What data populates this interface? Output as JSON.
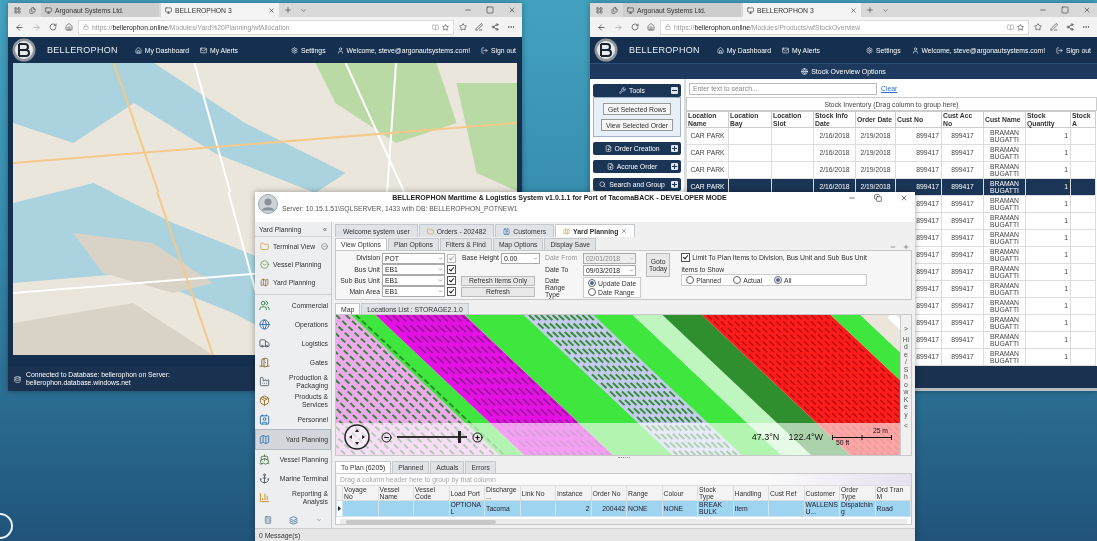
{
  "browser_windows": [
    {
      "kind": "map",
      "tabs": [
        {
          "label": "Argonaut Systems Ltd.",
          "selected": false
        },
        {
          "label": "BELLEROPHON 3",
          "selected": true
        }
      ],
      "url": "https://**bellerophon.online**/Modules/Yard%20Planning/wfAllocation",
      "nav": {
        "brand": "BELLEROPHON",
        "dashboard": "My Dashboard",
        "alerts": "My Alerts",
        "settings": "Settings",
        "welcome": "Welcome, steve@argonautsystems.com!",
        "sign_out": "Sign out"
      },
      "footer": "Connected to Database: bellerophon on Server: bellerophon.database.windows.net"
    },
    {
      "kind": "stock",
      "tabs": [
        {
          "label": "Argonaut Systems Ltd.",
          "selected": false
        },
        {
          "label": "BELLEROPHON 3",
          "selected": true
        }
      ],
      "url": "https://**bellerophon.online**/Modules/Products/wfStockOverview",
      "nav": {
        "brand": "BELLEROPHON",
        "dashboard": "My Dashboard",
        "alerts": "My Alerts",
        "settings": "Settings",
        "welcome": "Welcome, steve@argonautsystems.com!",
        "sign_out": "Sign out"
      },
      "options_bar": "Stock Overview Options",
      "tool_panels": [
        {
          "title": "Tools",
          "expanded": true,
          "buttons": [
            "Get Selected Rows",
            "View Selected Order"
          ]
        },
        {
          "title": "Order Creation",
          "expanded": false
        },
        {
          "title": "Accrue Order",
          "expanded": false
        },
        {
          "title": "Search and Group",
          "expanded": false
        }
      ],
      "search": {
        "placeholder": "Enter text to search...",
        "clear": "Clear"
      },
      "group_hint": "Stock Inventory (Drag column to group here)",
      "table": {
        "columns": [
          "Location Name",
          "Location Bay",
          "Location Slot",
          "Stock Info Date",
          "Order Date",
          "Cust No",
          "Cust Acc No",
          "Cust Name",
          "Stock Quantity",
          "Stock A"
        ],
        "rows": [
          {
            "selected": false,
            "cells": [
              "CAR PARK",
              null,
              null,
              "2/16/2018",
              "2/19/2018",
              "899417",
              "899417",
              "BRAMAN BUGATTI",
              "1"
            ]
          },
          {
            "selected": false,
            "cells": [
              "CAR PARK",
              null,
              null,
              "2/16/2018",
              "2/19/2018",
              "899417",
              "899417",
              "BRAMAN BUGATTI",
              "1"
            ]
          },
          {
            "selected": false,
            "cells": [
              "CAR PARK",
              null,
              null,
              "2/16/2018",
              "2/19/2018",
              "899417",
              "899417",
              "BRAMAN BUGATTI",
              "1"
            ]
          },
          {
            "selected": true,
            "cells": [
              "CAR PARK",
              null,
              null,
              "2/16/2018",
              "2/19/2018",
              "899417",
              "899417",
              "BRAMAN BUGATTI",
              "1"
            ]
          },
          {
            "selected": false,
            "cells": [
              null,
              null,
              null,
              null,
              null,
              "899417",
              "899417",
              "BRAMAN BUGATTI",
              "1"
            ]
          },
          {
            "selected": false,
            "cells": [
              null,
              null,
              null,
              null,
              null,
              "899417",
              "899417",
              "BRAMAN BUGATTI",
              "1"
            ]
          },
          {
            "selected": false,
            "cells": [
              null,
              null,
              null,
              null,
              null,
              "899417",
              "899417",
              "BRAMAN BUGATTI",
              "1"
            ]
          },
          {
            "selected": false,
            "cells": [
              null,
              null,
              null,
              null,
              null,
              "899417",
              "899417",
              "BRAMAN BUGATTI",
              "1"
            ]
          },
          {
            "selected": false,
            "cells": [
              null,
              null,
              null,
              null,
              null,
              "899417",
              "899417",
              "BRAMAN BUGATTI",
              "1"
            ]
          },
          {
            "selected": false,
            "cells": [
              null,
              null,
              null,
              null,
              null,
              "899417",
              "899417",
              "BRAMAN BUGATTI",
              "1"
            ]
          },
          {
            "selected": false,
            "cells": [
              null,
              null,
              null,
              null,
              null,
              "899417",
              "899417",
              "BRAMAN BUGATTI",
              "1"
            ]
          },
          {
            "selected": false,
            "cells": [
              null,
              null,
              null,
              null,
              null,
              "899417",
              "899417",
              "BRAMAN BUGATTI",
              "1"
            ]
          },
          {
            "selected": false,
            "cells": [
              null,
              null,
              null,
              null,
              null,
              "899417",
              "899417",
              "BRAMAN BUGATTI",
              "1"
            ]
          },
          {
            "selected": false,
            "cells": [
              null,
              null,
              null,
              null,
              null,
              "899417",
              "899417",
              "BRAMAN BUGATTI",
              "1"
            ]
          }
        ]
      }
    }
  ],
  "app": {
    "title": "BELLEROPHON Maritime & Logistics System v1.0.1.1 for Port of TacomaBACK - DEVELOPER MODE",
    "server": "Server: 10.15.1.51\\SQLSERVER, 1433 with DB: BELLEROPHON_POTNEW1",
    "sidebar": {
      "title": "Yard Planning",
      "collapse": "«",
      "quick_items": [
        "Terminal View",
        "Vessel Planning",
        "Yard Planning"
      ],
      "modules": [
        {
          "label": "Commercial",
          "selected": false
        },
        {
          "label": "Operations",
          "selected": false
        },
        {
          "label": "Logistics",
          "selected": false
        },
        {
          "label": "Gates",
          "selected": false
        },
        {
          "label": "Production & Packaging",
          "selected": false
        },
        {
          "label": "Products & Services",
          "selected": false
        },
        {
          "label": "Personnel",
          "selected": false
        },
        {
          "label": "Yard Planning",
          "selected": true
        },
        {
          "label": "Vessel Planning",
          "selected": false
        },
        {
          "label": "Marine Terminal",
          "selected": false
        },
        {
          "label": "Reporting & Analysis",
          "selected": false
        }
      ]
    },
    "doc_tabs": [
      {
        "label": "Welcome system user",
        "selected": false
      },
      {
        "label": "Orders - 202482",
        "selected": false
      },
      {
        "label": "Customers",
        "selected": false
      },
      {
        "label": "Yard Planning",
        "selected": true
      }
    ],
    "option_tabs": [
      {
        "label": "View Options",
        "selected": true
      },
      {
        "label": "Plan Options",
        "selected": false
      },
      {
        "label": "Filters & Find",
        "selected": false
      },
      {
        "label": "Map Options",
        "selected": false
      },
      {
        "label": "Display Save",
        "selected": false
      }
    ],
    "form": {
      "combos": [
        {
          "label": "Division",
          "value": "POT",
          "checked": true,
          "disabled": true
        },
        {
          "label": "Bus Unit",
          "value": "EB1",
          "checked": true,
          "disabled": false
        },
        {
          "label": "Sub Bus Unit",
          "value": "EB1",
          "checked": true,
          "disabled": false
        },
        {
          "label": "Main Area",
          "value": "EB1",
          "checked": true,
          "disabled": false
        }
      ],
      "base_height": {
        "label": "Base Height",
        "value": "0.00"
      },
      "buttons": [
        "Refresh Items Only",
        "Refresh"
      ],
      "dates": [
        {
          "label": "Date From",
          "value": "02/01/2018",
          "disabled": true
        },
        {
          "label": "Date To",
          "value": "09/03/2018",
          "disabled": false
        }
      ],
      "date_range_type": {
        "label": "Date Range Type",
        "options": [
          {
            "label": "Update Date",
            "selected": true
          },
          {
            "label": "Date Range",
            "selected": false
          }
        ]
      },
      "goto_today": "Goto Today",
      "limit": {
        "label": "Limit To Plan Items to Division, Bus Unit and Sub Bus Unit",
        "checked": true
      },
      "items_to_show": {
        "label": "Items to Show",
        "options": [
          {
            "label": "Planned",
            "selected": false
          },
          {
            "label": "Actual",
            "selected": false
          },
          {
            "label": "All",
            "selected": true
          }
        ]
      }
    },
    "map_tabs": [
      {
        "label": "Map",
        "selected": true
      },
      {
        "label": "Locations List : STORAGE2.1.0",
        "selected": false
      }
    ],
    "map": {
      "zoom": {
        "level": 0.9
      },
      "lat": "47.3°N",
      "lon": "122.4°W",
      "scale": {
        "top": "25 m",
        "bottom": "50 ft"
      },
      "key_toggle": {
        "open": ">",
        "label": "Hide / Show Key",
        "close": "<"
      }
    },
    "result_tabs": [
      {
        "label": "To Plan (6205)",
        "selected": true
      },
      {
        "label": "Planned",
        "selected": false
      },
      {
        "label": "Actuals",
        "selected": false
      },
      {
        "label": "Errors",
        "selected": false
      }
    ],
    "grid": {
      "group_hint": "Drag a column header here to group by that column",
      "columns": [
        "Voyage No",
        "Vessel Name",
        "Vessel Code",
        "Load Port",
        "Discharge ...",
        "Link No",
        "Instance",
        "Order No",
        "Range",
        "Colour",
        "Stock Type",
        "Handling",
        "Cust Ref",
        "Customer",
        "Order Type",
        "Ord Tran M"
      ],
      "rows": [
        {
          "selected": true,
          "cells": [
            null,
            null,
            null,
            "OPTIONAL",
            "Tacoma",
            null,
            "2",
            "200442",
            "NONE",
            "NONE",
            "BREAK BULK",
            "Item",
            null,
            "WALLENSU...",
            "Dispatching",
            "Road"
          ]
        }
      ]
    },
    "status": "0 Message(s)"
  }
}
